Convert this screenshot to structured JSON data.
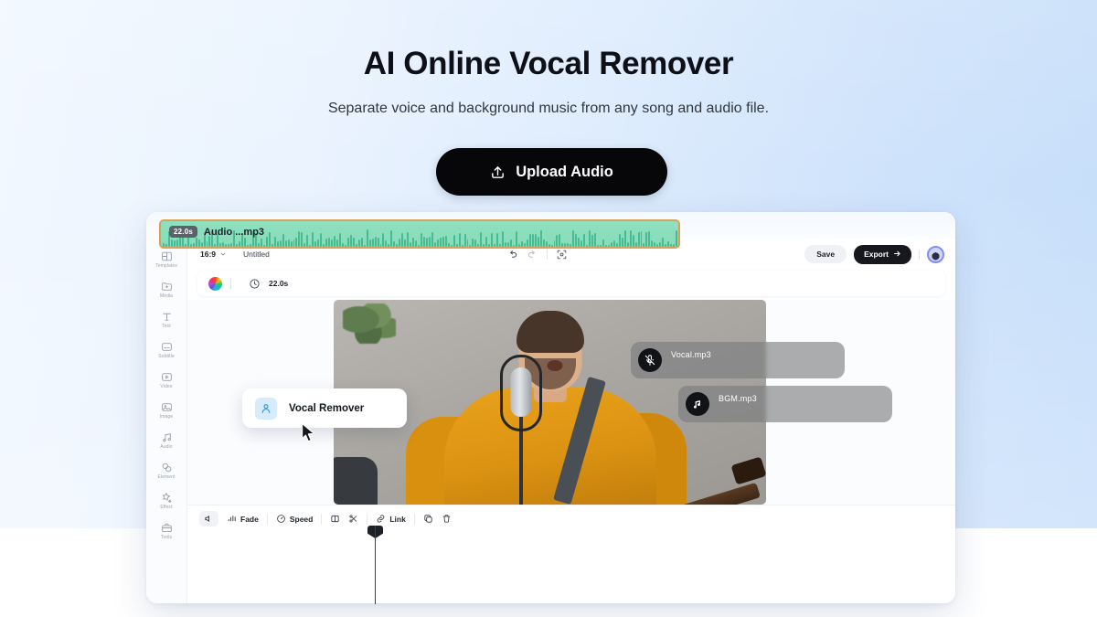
{
  "hero": {
    "title": "AI Online Vocal Remover",
    "subtitle": "Separate voice and background music from any song and audio file.",
    "upload_label": "Upload Audio",
    "upload_icon": "upload-arrow-icon"
  },
  "colors": {
    "bg_left": "#f2f8ff",
    "bg_right": "#c6defa",
    "accent_dark": "#07070a",
    "clip_fill": "#8fe0bf",
    "clip_border": "#d9a05b",
    "vr_icon_bg": "#d7ecfb"
  },
  "app": {
    "titlebar": {
      "lights": [
        "close-red",
        "minimize-yellow",
        "maximize-green"
      ]
    },
    "topbar": {
      "ratio": "16:9",
      "ratio_caret_icon": "chevron-down-icon",
      "project_name": "Untitled",
      "undo_icon": "undo-icon",
      "redo_icon": "redo-icon",
      "frame_icon": "crop-frame-icon",
      "save_label": "Save",
      "export_label": "Export",
      "export_arrow_icon": "arrow-right-icon",
      "avatar_icon": "user-avatar"
    },
    "subtoolbar": {
      "color_wheel_icon": "color-wheel-icon",
      "clock_icon": "clock-icon",
      "duration": "22.0s"
    },
    "sidebar": {
      "items": [
        {
          "label": "Templates",
          "icon": "templates-icon"
        },
        {
          "label": "Media",
          "icon": "media-folder-icon"
        },
        {
          "label": "Text",
          "icon": "text-icon"
        },
        {
          "label": "Subtitle",
          "icon": "subtitle-icon"
        },
        {
          "label": "Video",
          "icon": "video-icon"
        },
        {
          "label": "Image",
          "icon": "image-icon"
        },
        {
          "label": "Audio",
          "icon": "audio-note-icon"
        },
        {
          "label": "Element",
          "icon": "element-shapes-icon"
        },
        {
          "label": "Effect",
          "icon": "effect-sparkle-icon"
        },
        {
          "label": "Tools",
          "icon": "tools-briefcase-icon"
        }
      ]
    },
    "preview": {
      "scene_description": "Man in orange sweater singing into a studio microphone while holding a guitar",
      "vocal_card": {
        "name": "Vocal.mp3",
        "icon": "mic-muted-icon"
      },
      "bgm_card": {
        "name": "BGM.mp3",
        "icon": "music-note-icon"
      },
      "vocal_remover_popup": {
        "label": "Vocal Remover",
        "icon": "user-person-icon",
        "cursor_icon": "cursor-arrow-icon"
      }
    },
    "bottom_toolbar": {
      "items": [
        {
          "label": "",
          "icon": "volume-icon"
        },
        {
          "label": "Fade",
          "icon": "fade-bars-icon"
        },
        {
          "label": "Speed",
          "icon": "speed-gauge-icon"
        },
        {
          "label": "",
          "icon": "split-icon"
        },
        {
          "label": "",
          "icon": "scissors-icon"
        },
        {
          "label": "Link",
          "icon": "link-icon"
        },
        {
          "label": "",
          "icon": "copy-icon"
        },
        {
          "label": "",
          "icon": "trash-icon"
        }
      ]
    },
    "timeline": {
      "clip": {
        "duration_badge": "22.0s",
        "name": "Audio ...mp3"
      },
      "playhead_icon": "playhead-marker-icon"
    }
  }
}
